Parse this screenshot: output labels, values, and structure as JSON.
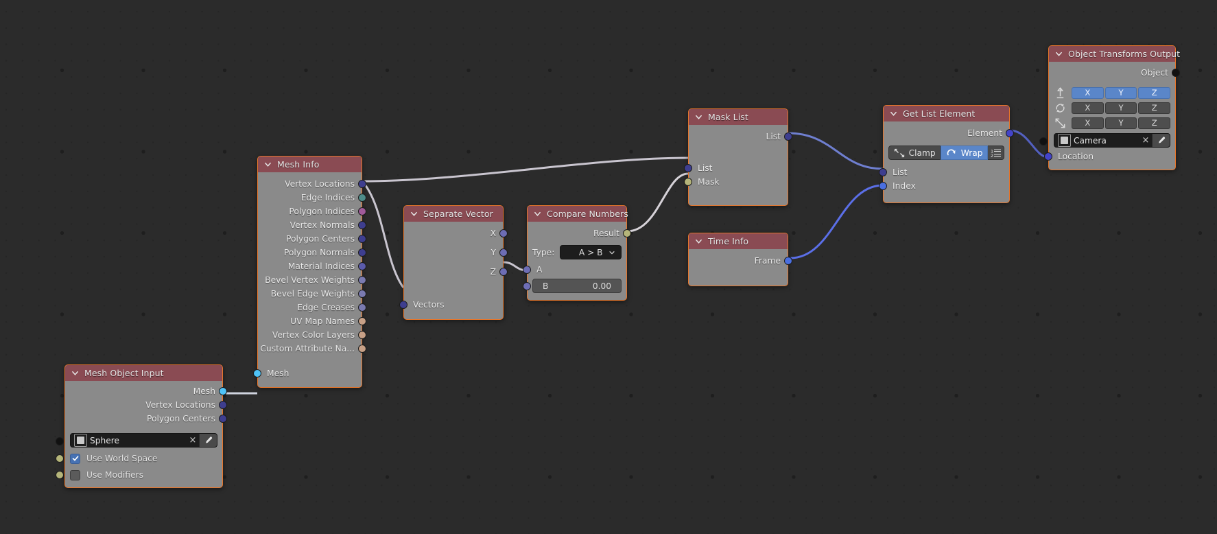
{
  "editor": {
    "background": "#2b2b2b",
    "node_border": "#e8762a",
    "header_color": "#8a4b53",
    "body_color": "#8a8a8a"
  },
  "nodes": {
    "mesh_object_input": {
      "title": "Mesh Object Input",
      "outputs": [
        "Mesh",
        "Vertex Locations",
        "Polygon Centers"
      ],
      "object_field": {
        "value": "Sphere",
        "clear": "×"
      },
      "checkboxes": [
        {
          "label": "Use World Space",
          "checked": true
        },
        {
          "label": "Use Modifiers",
          "checked": false
        }
      ]
    },
    "mesh_info": {
      "title": "Mesh Info",
      "outputs": [
        "Vertex Locations",
        "Edge Indices",
        "Polygon Indices",
        "Vertex Normals",
        "Polygon Centers",
        "Polygon Normals",
        "Material Indices",
        "Bevel Vertex Weights",
        "Bevel Edge Weights",
        "Edge Creases",
        "UV Map Names",
        "Vertex Color Layers",
        "Custom Attribute Na..."
      ],
      "inputs": [
        "Mesh"
      ]
    },
    "separate_vector": {
      "title": "Separate Vector",
      "outputs": [
        "X",
        "Y",
        "Z"
      ],
      "inputs": [
        "Vectors"
      ]
    },
    "compare_numbers": {
      "title": "Compare Numbers",
      "outputs": [
        "Result"
      ],
      "type_label": "Type:",
      "type_value": "A > B",
      "inputs": [
        "A"
      ],
      "b_field": {
        "label": "B",
        "value": "0.00"
      }
    },
    "mask_list": {
      "title": "Mask List",
      "outputs": [
        "List"
      ],
      "inputs": [
        "List",
        "Mask"
      ]
    },
    "time_info": {
      "title": "Time Info",
      "outputs": [
        "Frame"
      ]
    },
    "get_list_element": {
      "title": "Get List Element",
      "outputs": [
        "Element"
      ],
      "mode_buttons": [
        {
          "label": "Clamp",
          "active": false,
          "icon": "clamp-icon"
        },
        {
          "label": "Wrap",
          "active": true,
          "icon": "wrap-icon"
        }
      ],
      "list_icon": "list-order-icon",
      "inputs": [
        "List",
        "Index"
      ]
    },
    "object_transforms_output": {
      "title": "Object Transforms Output",
      "outputs": [
        "Object"
      ],
      "transform_rows": [
        {
          "icon": "location-icon",
          "axes": [
            "X",
            "Y",
            "Z"
          ],
          "active": [
            true,
            true,
            true
          ]
        },
        {
          "icon": "rotation-icon",
          "axes": [
            "X",
            "Y",
            "Z"
          ],
          "active": [
            false,
            false,
            false
          ]
        },
        {
          "icon": "scale-icon",
          "axes": [
            "X",
            "Y",
            "Z"
          ],
          "active": [
            false,
            false,
            false
          ]
        }
      ],
      "object_field": {
        "value": "Camera",
        "clear": "×"
      },
      "inputs": [
        "Location"
      ]
    }
  },
  "socket_colors": {
    "mesh": "#4fc3f7",
    "vector_list": "#3e3e8f",
    "integer_list": "#4f8d8a",
    "polygon_indices": "#a05a9a",
    "float_list": "#6d6db5",
    "string_list": "#c8a187",
    "boolean": "#b5b57a",
    "object": "#111111",
    "integer": "#4a6fe0",
    "vector": "#4444c8"
  },
  "link_colors": {
    "pale": "#c9c5cf",
    "blue": "#5c6ecb",
    "bright_blue": "#5b6fe8"
  }
}
